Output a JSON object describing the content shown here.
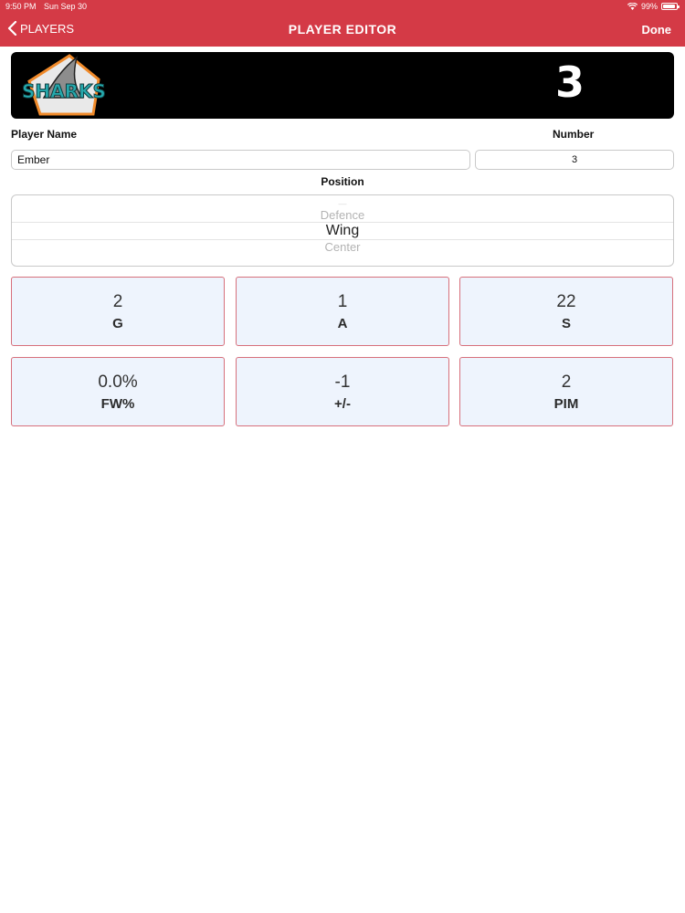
{
  "status_bar": {
    "time": "9:50 PM",
    "date": "Sun Sep 30",
    "battery": "99%"
  },
  "nav": {
    "back_label": "PLAYERS",
    "title": "PLAYER EDITOR",
    "done_label": "Done"
  },
  "banner": {
    "team_logo_text": "SHARKS",
    "number": "3"
  },
  "form": {
    "name_label": "Player Name",
    "name_value": "Ember",
    "number_label": "Number",
    "number_value": "3",
    "position_label": "Position"
  },
  "position_picker": {
    "above": "Defence",
    "selected": "Wing",
    "below": "Center"
  },
  "stats": [
    {
      "value": "2",
      "key": "G"
    },
    {
      "value": "1",
      "key": "A"
    },
    {
      "value": "22",
      "key": "S"
    },
    {
      "value": "0.0%",
      "key": "FW%"
    },
    {
      "value": "-1",
      "key": "+/-"
    },
    {
      "value": "2",
      "key": "PIM"
    }
  ],
  "colors": {
    "accent": "#d43a46",
    "tile_bg": "#eef4fd",
    "tile_border": "#d7707c",
    "logo_teal": "#25a9ad"
  }
}
